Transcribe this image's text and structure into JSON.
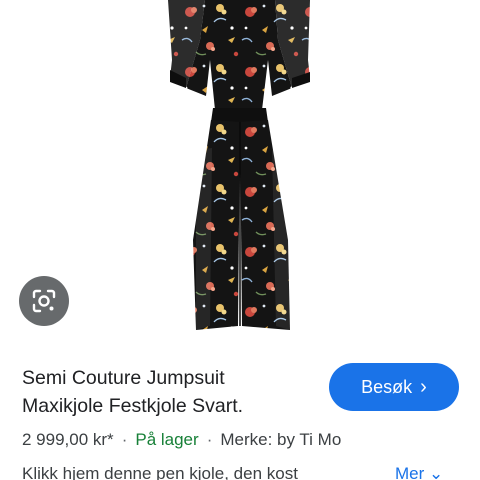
{
  "product": {
    "title_line1": "Semi Couture Jumpsuit",
    "title_line2": "Maxikjole Festkjole Svart.",
    "price": "2 999,00 kr*",
    "separator": "·",
    "stock": "På lager",
    "brand": "Merke: by Ti Mo",
    "description": "Klikk hjem denne pen kjole, den kost"
  },
  "actions": {
    "visit_label": "Besøk",
    "visit_chevron": "›",
    "more_label": "Mer ⌄"
  },
  "icons": {
    "lens": "google-lens-icon",
    "visit": "chevron-right-icon",
    "more": "chevron-down-icon"
  },
  "colors": {
    "accent": "#1a73e8",
    "stock_green": "#188038",
    "garment": "#141414"
  }
}
